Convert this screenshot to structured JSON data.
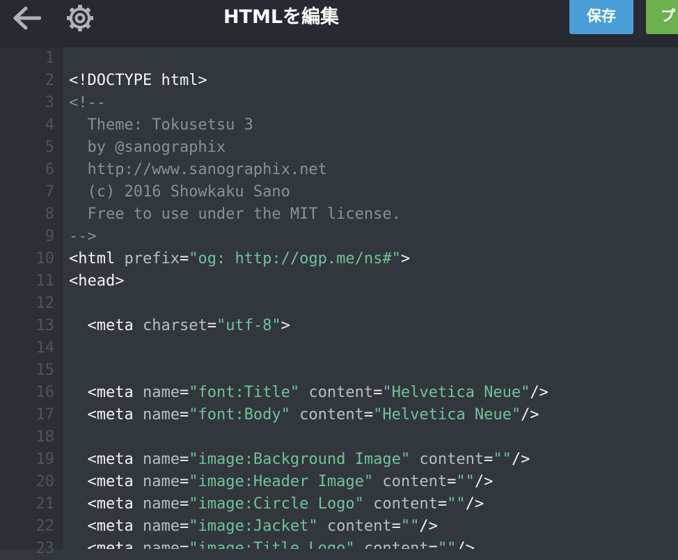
{
  "header": {
    "title": "HTMLを編集",
    "save_label": "保存",
    "preview_label": "プレビュー",
    "back_icon": "back-arrow-icon",
    "settings_icon": "gear-icon"
  },
  "colors": {
    "topbar_bg": "#272a30",
    "editor_bg": "#32363d",
    "gutter_bg": "#2c3036",
    "save_button": "#4a9ed8",
    "preview_button": "#6bb14d",
    "string": "#6fc49a",
    "comment": "#8a9099",
    "attribute": "#b9bec6",
    "tag": "#f2f4f7"
  },
  "editor": {
    "lines": [
      {
        "n": "1",
        "tokens": []
      },
      {
        "n": "2",
        "tokens": [
          {
            "t": "tag",
            "v": "<!DOCTYPE html>"
          }
        ]
      },
      {
        "n": "3",
        "tokens": [
          {
            "t": "comment",
            "v": "<!--"
          }
        ]
      },
      {
        "n": "4",
        "tokens": [
          {
            "t": "comment",
            "v": "  Theme: Tokusetsu 3"
          }
        ]
      },
      {
        "n": "5",
        "tokens": [
          {
            "t": "comment",
            "v": "  by @sanographix"
          }
        ]
      },
      {
        "n": "6",
        "tokens": [
          {
            "t": "comment",
            "v": "  http://www.sanographix.net"
          }
        ]
      },
      {
        "n": "7",
        "tokens": [
          {
            "t": "comment",
            "v": "  (c) 2016 Showkaku Sano"
          }
        ]
      },
      {
        "n": "8",
        "tokens": [
          {
            "t": "comment",
            "v": "  Free to use under the MIT license."
          }
        ]
      },
      {
        "n": "9",
        "tokens": [
          {
            "t": "comment",
            "v": "-->"
          }
        ]
      },
      {
        "n": "10",
        "tokens": [
          {
            "t": "tag",
            "v": "<html"
          },
          {
            "t": "plain",
            "v": " "
          },
          {
            "t": "attr",
            "v": "prefix"
          },
          {
            "t": "plain",
            "v": "="
          },
          {
            "t": "str",
            "v": "\"og: http://ogp.me/ns#\""
          },
          {
            "t": "tag",
            "v": ">"
          }
        ]
      },
      {
        "n": "11",
        "tokens": [
          {
            "t": "tag",
            "v": "<head>"
          }
        ]
      },
      {
        "n": "12",
        "tokens": []
      },
      {
        "n": "13",
        "tokens": [
          {
            "t": "plain",
            "v": "  "
          },
          {
            "t": "tag",
            "v": "<meta"
          },
          {
            "t": "plain",
            "v": " "
          },
          {
            "t": "attr",
            "v": "charset"
          },
          {
            "t": "plain",
            "v": "="
          },
          {
            "t": "str",
            "v": "\"utf-8\""
          },
          {
            "t": "tag",
            "v": ">"
          }
        ]
      },
      {
        "n": "14",
        "tokens": []
      },
      {
        "n": "15",
        "tokens": []
      },
      {
        "n": "16",
        "tokens": [
          {
            "t": "plain",
            "v": "  "
          },
          {
            "t": "tag",
            "v": "<meta"
          },
          {
            "t": "plain",
            "v": " "
          },
          {
            "t": "attr",
            "v": "name"
          },
          {
            "t": "plain",
            "v": "="
          },
          {
            "t": "str",
            "v": "\"font:Title\""
          },
          {
            "t": "plain",
            "v": " "
          },
          {
            "t": "attr",
            "v": "content"
          },
          {
            "t": "plain",
            "v": "="
          },
          {
            "t": "str",
            "v": "\"Helvetica Neue\""
          },
          {
            "t": "tag",
            "v": "/>"
          }
        ]
      },
      {
        "n": "17",
        "tokens": [
          {
            "t": "plain",
            "v": "  "
          },
          {
            "t": "tag",
            "v": "<meta"
          },
          {
            "t": "plain",
            "v": " "
          },
          {
            "t": "attr",
            "v": "name"
          },
          {
            "t": "plain",
            "v": "="
          },
          {
            "t": "str",
            "v": "\"font:Body\""
          },
          {
            "t": "plain",
            "v": " "
          },
          {
            "t": "attr",
            "v": "content"
          },
          {
            "t": "plain",
            "v": "="
          },
          {
            "t": "str",
            "v": "\"Helvetica Neue\""
          },
          {
            "t": "tag",
            "v": "/>"
          }
        ]
      },
      {
        "n": "18",
        "tokens": []
      },
      {
        "n": "19",
        "tokens": [
          {
            "t": "plain",
            "v": "  "
          },
          {
            "t": "tag",
            "v": "<meta"
          },
          {
            "t": "plain",
            "v": " "
          },
          {
            "t": "attr",
            "v": "name"
          },
          {
            "t": "plain",
            "v": "="
          },
          {
            "t": "str",
            "v": "\"image:Background Image\""
          },
          {
            "t": "plain",
            "v": " "
          },
          {
            "t": "attr",
            "v": "content"
          },
          {
            "t": "plain",
            "v": "="
          },
          {
            "t": "str",
            "v": "\"\""
          },
          {
            "t": "tag",
            "v": "/>"
          }
        ]
      },
      {
        "n": "20",
        "tokens": [
          {
            "t": "plain",
            "v": "  "
          },
          {
            "t": "tag",
            "v": "<meta"
          },
          {
            "t": "plain",
            "v": " "
          },
          {
            "t": "attr",
            "v": "name"
          },
          {
            "t": "plain",
            "v": "="
          },
          {
            "t": "str",
            "v": "\"image:Header Image\""
          },
          {
            "t": "plain",
            "v": " "
          },
          {
            "t": "attr",
            "v": "content"
          },
          {
            "t": "plain",
            "v": "="
          },
          {
            "t": "str",
            "v": "\"\""
          },
          {
            "t": "tag",
            "v": "/>"
          }
        ]
      },
      {
        "n": "21",
        "tokens": [
          {
            "t": "plain",
            "v": "  "
          },
          {
            "t": "tag",
            "v": "<meta"
          },
          {
            "t": "plain",
            "v": " "
          },
          {
            "t": "attr",
            "v": "name"
          },
          {
            "t": "plain",
            "v": "="
          },
          {
            "t": "str",
            "v": "\"image:Circle Logo\""
          },
          {
            "t": "plain",
            "v": " "
          },
          {
            "t": "attr",
            "v": "content"
          },
          {
            "t": "plain",
            "v": "="
          },
          {
            "t": "str",
            "v": "\"\""
          },
          {
            "t": "tag",
            "v": "/>"
          }
        ]
      },
      {
        "n": "22",
        "tokens": [
          {
            "t": "plain",
            "v": "  "
          },
          {
            "t": "tag",
            "v": "<meta"
          },
          {
            "t": "plain",
            "v": " "
          },
          {
            "t": "attr",
            "v": "name"
          },
          {
            "t": "plain",
            "v": "="
          },
          {
            "t": "str",
            "v": "\"image:Jacket\""
          },
          {
            "t": "plain",
            "v": " "
          },
          {
            "t": "attr",
            "v": "content"
          },
          {
            "t": "plain",
            "v": "="
          },
          {
            "t": "str",
            "v": "\"\""
          },
          {
            "t": "tag",
            "v": "/>"
          }
        ]
      },
      {
        "n": "23",
        "tokens": [
          {
            "t": "plain",
            "v": "  "
          },
          {
            "t": "tag",
            "v": "<meta"
          },
          {
            "t": "plain",
            "v": " "
          },
          {
            "t": "attr",
            "v": "name"
          },
          {
            "t": "plain",
            "v": "="
          },
          {
            "t": "str",
            "v": "\"image:Title Logo\""
          },
          {
            "t": "plain",
            "v": " "
          },
          {
            "t": "attr",
            "v": "content"
          },
          {
            "t": "plain",
            "v": "="
          },
          {
            "t": "str",
            "v": "\"\""
          },
          {
            "t": "tag",
            "v": "/>"
          }
        ]
      }
    ]
  }
}
